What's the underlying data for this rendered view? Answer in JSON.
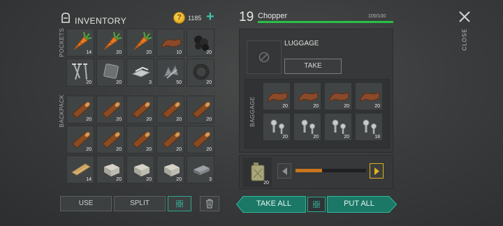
{
  "inventory": {
    "title": "INVENTORY",
    "coins": "1185",
    "add_coins": "+",
    "pockets_label": "POCKETS",
    "backpack_label": "BACKPACK",
    "pockets": [
      {
        "icon": "carrot",
        "qty": "14"
      },
      {
        "icon": "carrot",
        "qty": "20"
      },
      {
        "icon": "carrot",
        "qty": "20"
      },
      {
        "icon": "leather",
        "qty": "10"
      },
      {
        "icon": "coal",
        "qty": "20"
      },
      {
        "icon": "nails",
        "qty": "20"
      },
      {
        "icon": "metal-plate",
        "qty": "20"
      },
      {
        "icon": "iron-bars",
        "qty": "3"
      },
      {
        "icon": "scrap-metal",
        "qty": "50"
      },
      {
        "icon": "rubber-tire",
        "qty": "20"
      }
    ],
    "backpack": [
      {
        "icon": "log",
        "qty": "20"
      },
      {
        "icon": "log",
        "qty": "20"
      },
      {
        "icon": "log",
        "qty": "20"
      },
      {
        "icon": "log",
        "qty": "20"
      },
      {
        "icon": "log",
        "qty": "20"
      },
      {
        "icon": "log",
        "qty": "20"
      },
      {
        "icon": "log",
        "qty": "20"
      },
      {
        "icon": "log",
        "qty": "20"
      },
      {
        "icon": "log",
        "qty": "20"
      },
      {
        "icon": "log",
        "qty": "20"
      },
      {
        "icon": "plank",
        "qty": "14"
      },
      {
        "icon": "stone-block",
        "qty": "20"
      },
      {
        "icon": "stone-block",
        "qty": "20"
      },
      {
        "icon": "stone-block",
        "qty": "20"
      },
      {
        "icon": "steel-ingot",
        "qty": "3"
      }
    ],
    "buttons": {
      "use": "USE",
      "split": "SPLIT"
    }
  },
  "player": {
    "level": "19",
    "name": "Chopper",
    "hp": "100/100",
    "hp_fraction": 1.0
  },
  "container": {
    "luggage_label": "LUGGAGE",
    "take_label": "TAKE",
    "baggage_label": "BAGGAGE",
    "baggage": [
      {
        "icon": "leather",
        "qty": "20"
      },
      {
        "icon": "leather",
        "qty": "20"
      },
      {
        "icon": "leather",
        "qty": "20"
      },
      {
        "icon": "leather",
        "qty": "20"
      },
      {
        "icon": "bolts",
        "qty": "20"
      },
      {
        "icon": "bolts",
        "qty": "20"
      },
      {
        "icon": "bolts",
        "qty": "20"
      },
      {
        "icon": "bolts",
        "qty": "18"
      }
    ],
    "fuel_qty": "20",
    "fuel_fraction": 0.38,
    "take_all": "TAKE ALL",
    "put_all": "PUT ALL"
  },
  "close_label": "CLOSE",
  "colors": {
    "accent_teal": "#2fb89c",
    "health_green": "#29c047",
    "slider_orange": "#c8751e",
    "arrow_yellow": "#e0b21a"
  }
}
